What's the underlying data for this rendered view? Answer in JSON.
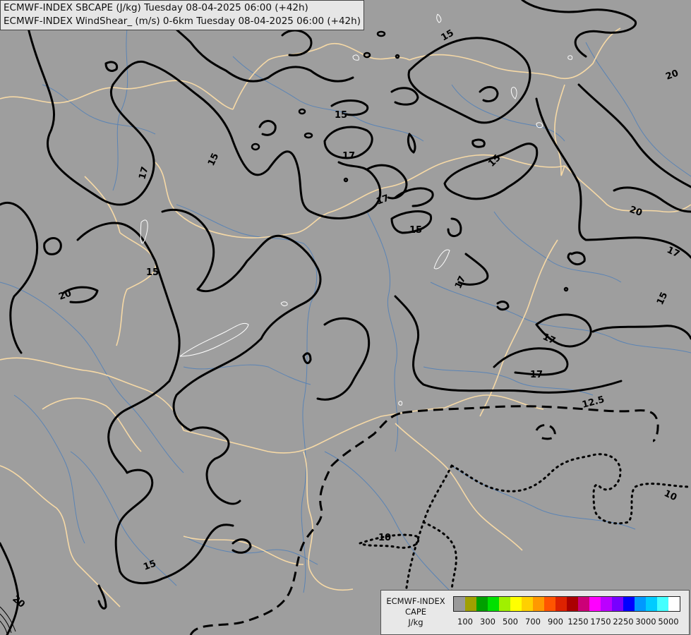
{
  "header": {
    "line1": "ECMWF-INDEX SBCAPE (J/kg) Tuesday 08-04-2025 06:00 (+42h)",
    "line2": "ECMWF-INDEX WindShear_ (m/s) 0-6km Tuesday 08-04-2025 06:00 (+42h)"
  },
  "map": {
    "background": "#9e9e9e",
    "border_color": "#f6d9a6",
    "river_color": "#4f7fb8",
    "contour_color": "#000000",
    "contour_labels": [
      "15",
      "15",
      "15",
      "15",
      "15",
      "15",
      "15",
      "15",
      "15",
      "17",
      "17",
      "17",
      "17",
      "17",
      "17",
      "17",
      "17",
      "20",
      "20",
      "20",
      "20",
      "12.5",
      "10",
      "10"
    ]
  },
  "legend": {
    "title_lines": [
      "ECMWF-INDEX",
      "CAPE",
      "J/kg"
    ],
    "colors": [
      "#999999",
      "#a0a000",
      "#00a000",
      "#00e000",
      "#a0f000",
      "#ffff00",
      "#ffd000",
      "#ff9900",
      "#ff5500",
      "#dd2200",
      "#aa0000",
      "#cc0077",
      "#ff00ff",
      "#bb00ff",
      "#7700ff",
      "#0000ff",
      "#0099ff",
      "#00ccff",
      "#44ffff",
      "#ffffff"
    ],
    "tick_labels": [
      "100",
      "300",
      "500",
      "700",
      "900",
      "1250",
      "1750",
      "2250",
      "3000",
      "5000"
    ]
  }
}
